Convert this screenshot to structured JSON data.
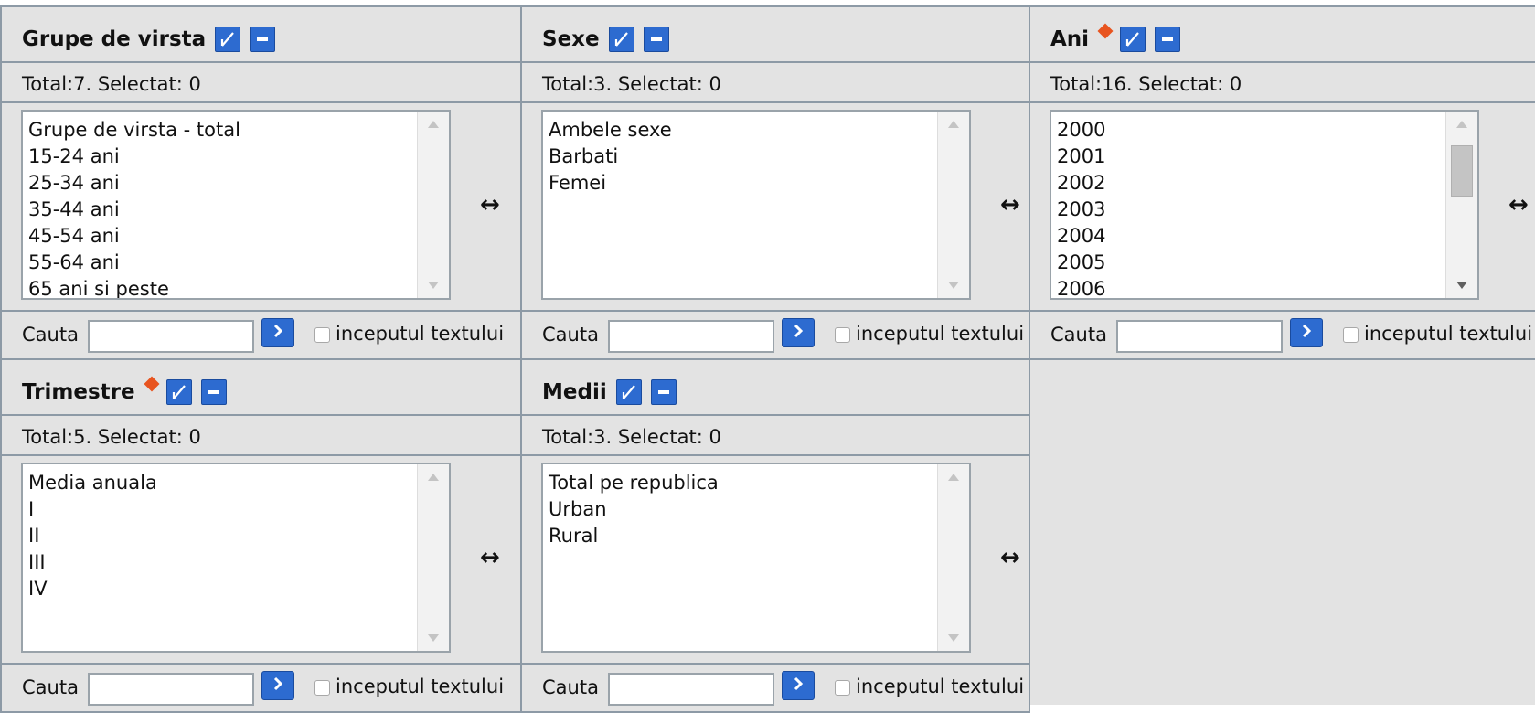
{
  "swap_glyph": "↔",
  "search_label": "Cauta",
  "begin_label": "inceputul textului",
  "panels": [
    {
      "title": "Grupe de virsta",
      "required": false,
      "total": "Total:7. Selectat: 0",
      "items": [
        "Grupe de virsta - total",
        "15-24 ani",
        "25-34 ani",
        "35-44 ani",
        "45-54 ani",
        "55-64 ani",
        "65 ani si peste"
      ],
      "scroll": false
    },
    {
      "title": "Sexe",
      "required": false,
      "total": "Total:3. Selectat: 0",
      "items": [
        "Ambele sexe",
        "Barbati",
        "Femei"
      ],
      "scroll": false
    },
    {
      "title": "Ani",
      "required": true,
      "total": "Total:16. Selectat: 0",
      "items": [
        "2000",
        "2001",
        "2002",
        "2003",
        "2004",
        "2005",
        "2006"
      ],
      "scroll": true
    },
    {
      "title": "Trimestre",
      "required": true,
      "total": "Total:5. Selectat: 0",
      "items": [
        "Media anuala",
        "I",
        "II",
        "III",
        "IV"
      ],
      "scroll": false
    },
    {
      "title": "Medii",
      "required": false,
      "total": "Total:3. Selectat: 0",
      "items": [
        "Total pe republica",
        "Urban",
        "Rural"
      ],
      "scroll": false
    }
  ],
  "colors": {
    "panel_bg": "#e3e3e3",
    "border": "#8d9aa6",
    "button_blue": "#2d6bd0",
    "required_marker": "#e8541f"
  }
}
